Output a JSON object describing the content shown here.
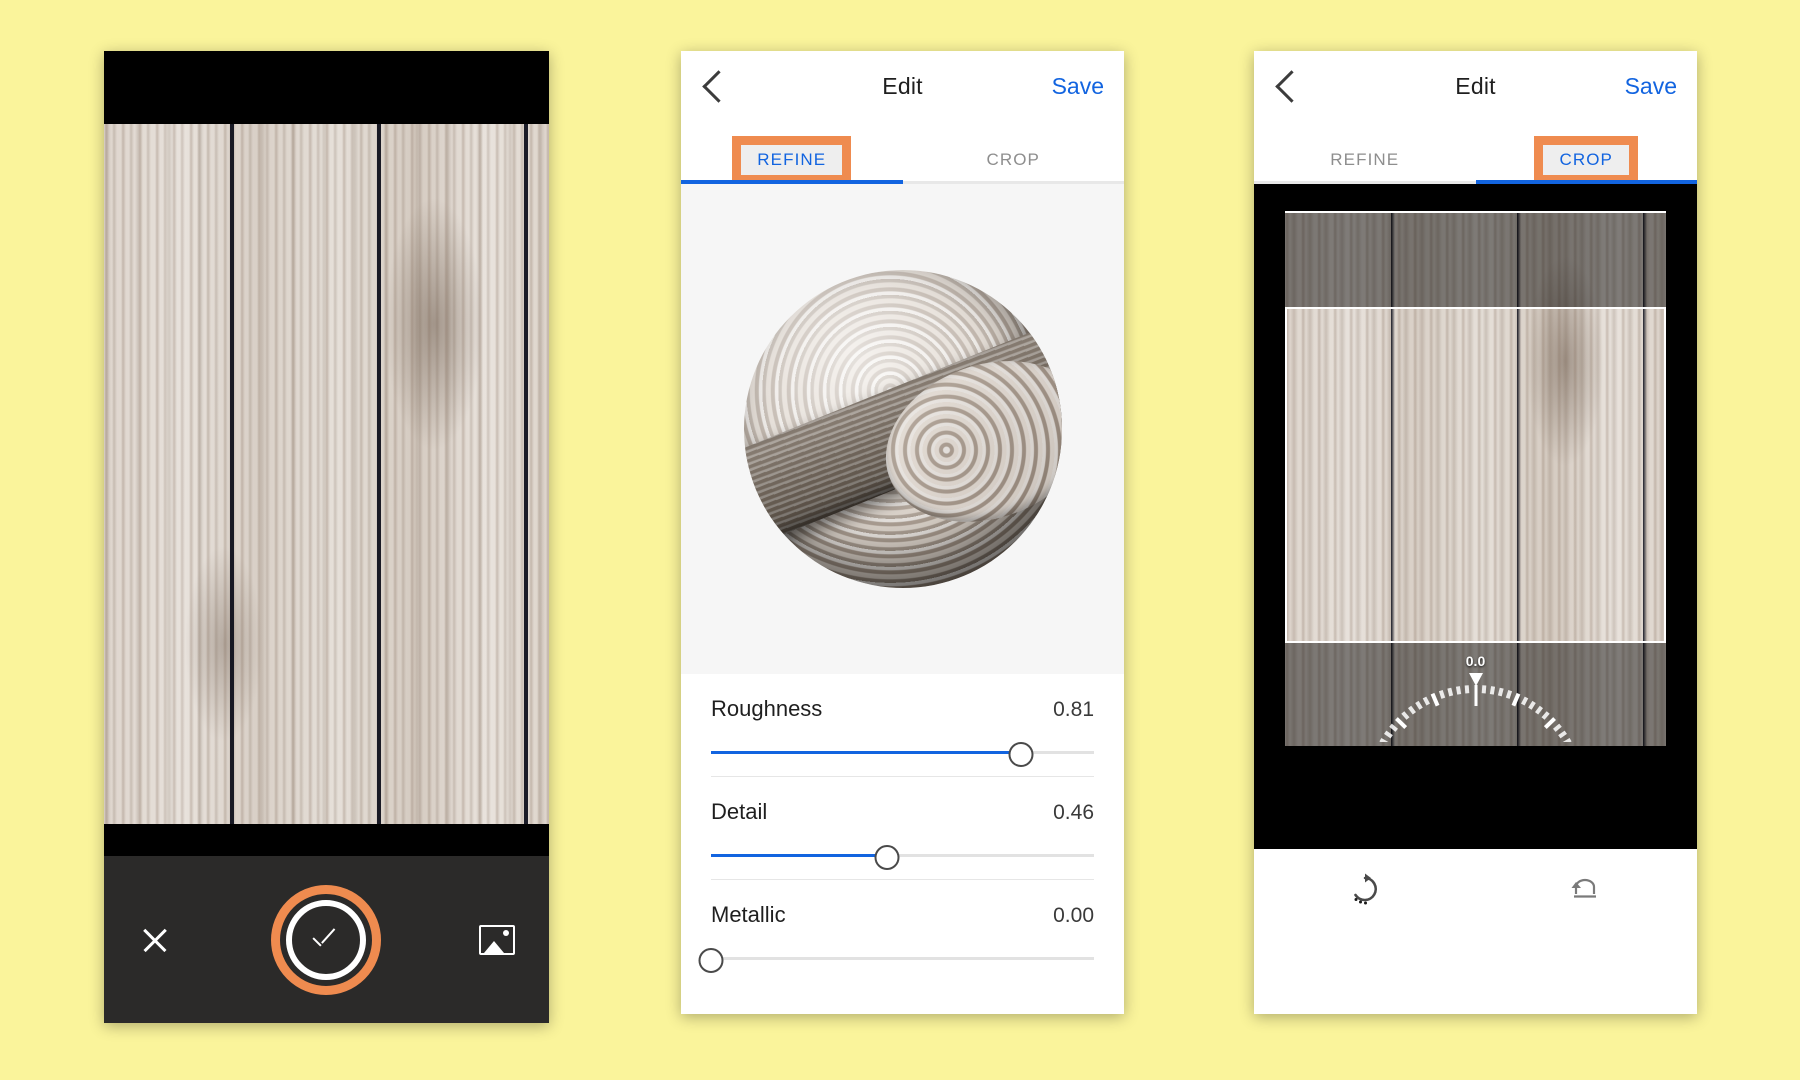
{
  "background_color": "#faf49b",
  "accent_highlight_color": "#ef8b4f",
  "link_color": "#1264e0",
  "panels": {
    "camera": {
      "name": "camera-capture-screen",
      "close_icon": "close-x-icon",
      "shutter_icon": "checkmark-confirm-icon",
      "gallery_icon": "photo-gallery-icon"
    },
    "refine": {
      "nav": {
        "back_icon": "back-chevron-icon",
        "title": "Edit",
        "save_label": "Save"
      },
      "tabs": [
        {
          "label": "REFINE",
          "active": true,
          "highlighted": true
        },
        {
          "label": "CROP",
          "active": false,
          "highlighted": false
        }
      ],
      "preview_icon": "material-preview-sphere",
      "sliders": [
        {
          "label": "Roughness",
          "value": "0.81",
          "fraction": 0.81
        },
        {
          "label": "Detail",
          "value": "0.46",
          "fraction": 0.46
        },
        {
          "label": "Metallic",
          "value": "0.00",
          "fraction": 0.0
        }
      ]
    },
    "crop": {
      "nav": {
        "back_icon": "back-chevron-icon",
        "title": "Edit",
        "save_label": "Save"
      },
      "tabs": [
        {
          "label": "REFINE",
          "active": false,
          "highlighted": false
        },
        {
          "label": "CROP",
          "active": true,
          "highlighted": true
        }
      ],
      "rotation_value": "0.0",
      "toolbar": [
        {
          "icon": "rotate-clockwise-icon"
        },
        {
          "icon": "reset-undo-icon"
        }
      ]
    }
  }
}
